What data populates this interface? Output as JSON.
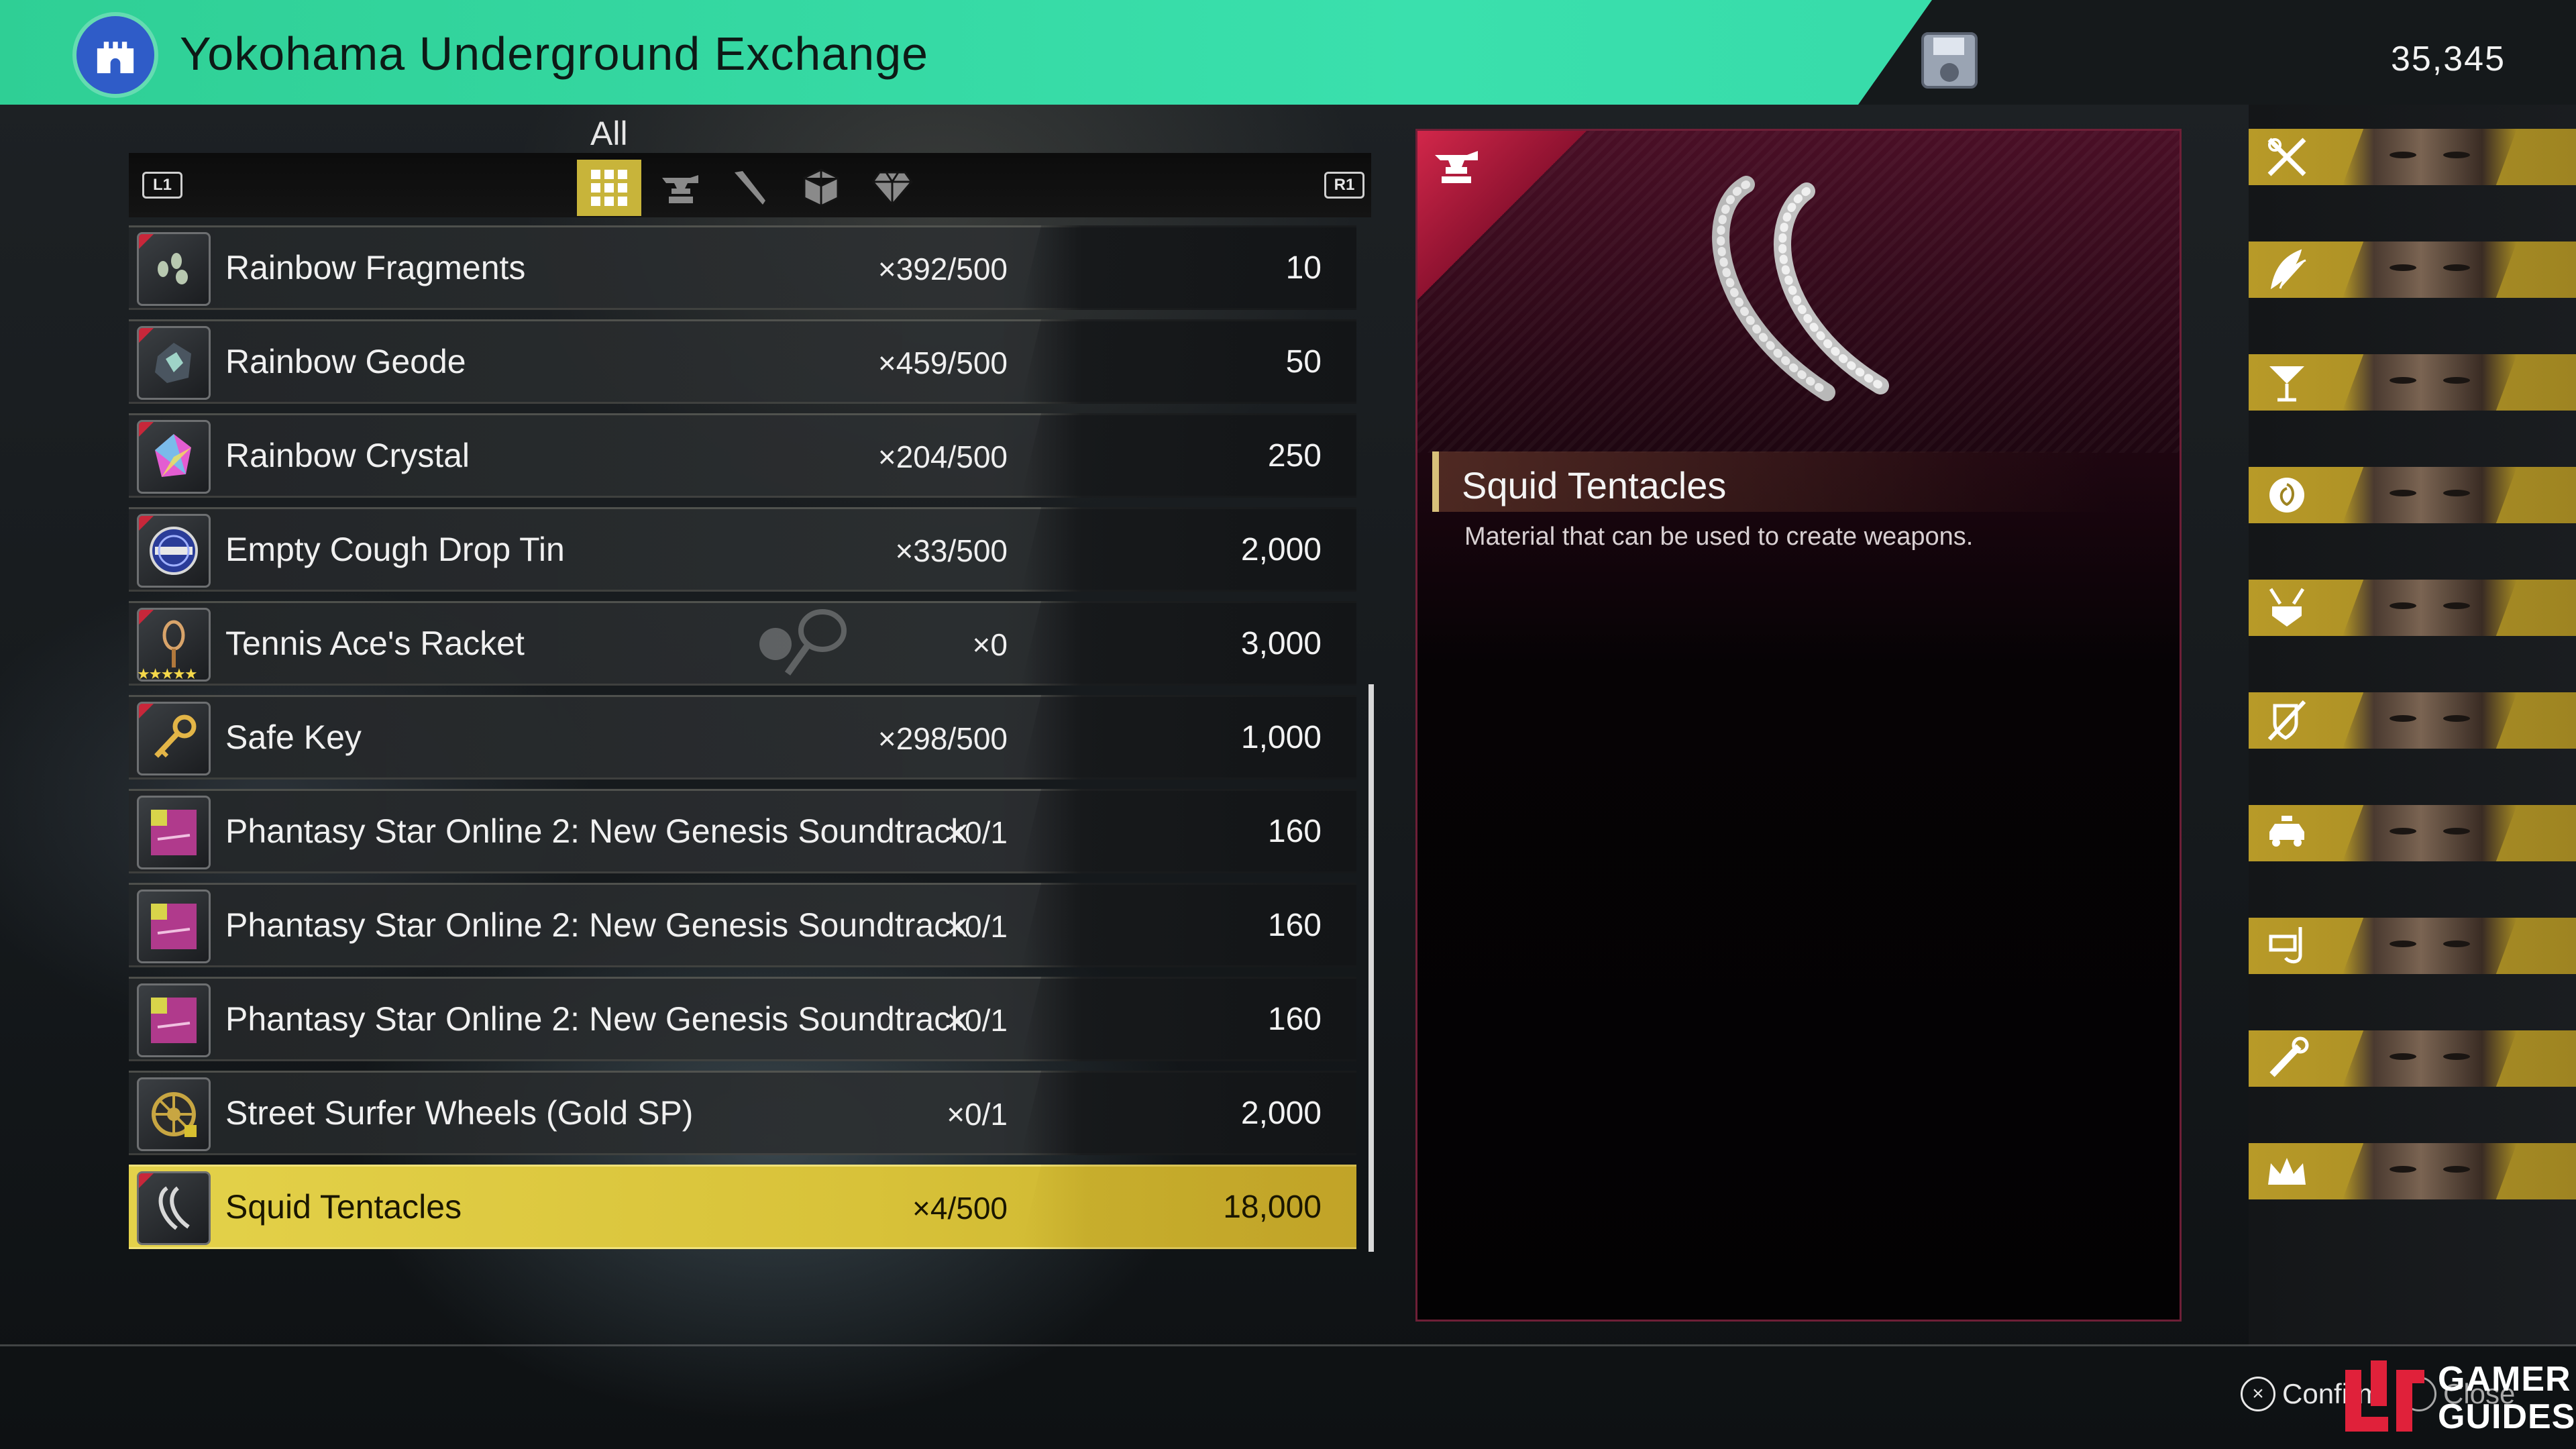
{
  "header": {
    "title": "Yokohama Underground Exchange",
    "money": "35,345"
  },
  "categories": {
    "active_label": "All",
    "left_button": "L1",
    "right_button": "R1",
    "tabs": [
      {
        "icon": "grid-icon",
        "active": true
      },
      {
        "icon": "anvil-icon",
        "active": false
      },
      {
        "icon": "needle-icon",
        "active": false
      },
      {
        "icon": "box-icon",
        "active": false
      },
      {
        "icon": "gem-icon",
        "active": false
      }
    ]
  },
  "items": [
    {
      "name": "Rainbow Fragments",
      "qty": "×392/500",
      "price": "10",
      "icon": "fragments-icon"
    },
    {
      "name": "Rainbow Geode",
      "qty": "×459/500",
      "price": "50",
      "icon": "geode-icon"
    },
    {
      "name": "Rainbow Crystal",
      "qty": "×204/500",
      "price": "250",
      "icon": "crystal-icon"
    },
    {
      "name": "Empty Cough Drop Tin",
      "qty": "×33/500",
      "price": "2,000",
      "icon": "tin-icon"
    },
    {
      "name": "Tennis Ace's Racket",
      "qty": "×0",
      "price": "3,000",
      "icon": "racket-icon",
      "stars": "★★★★★"
    },
    {
      "name": "Safe Key",
      "qty": "×298/500",
      "price": "1,000",
      "icon": "key-icon"
    },
    {
      "name": "Phantasy Star Online 2: New Genesis Soundtrack",
      "qty": "×0/1",
      "price": "160",
      "icon": "album-icon"
    },
    {
      "name": "Phantasy Star Online 2: New Genesis Soundtrack",
      "qty": "×0/1",
      "price": "160",
      "icon": "album-icon"
    },
    {
      "name": "Phantasy Star Online 2: New Genesis Soundtrack",
      "qty": "×0/1",
      "price": "160",
      "icon": "album-icon"
    },
    {
      "name": "Street Surfer Wheels (Gold SP)",
      "qty": "×0/1",
      "price": "2,000",
      "icon": "wheel-icon"
    },
    {
      "name": "Squid Tentacles",
      "qty": "×4/500",
      "price": "18,000",
      "icon": "tentacle-icon",
      "selected": true
    }
  ],
  "detail": {
    "name": "Squid Tentacles",
    "description": "Material that can be used to create weapons.",
    "category_icon": "anvil-icon"
  },
  "party": [
    {
      "job": "crossed-swords-icon"
    },
    {
      "job": "feathers-icon"
    },
    {
      "job": "cocktail-icon"
    },
    {
      "job": "rose-icon"
    },
    {
      "job": "samurai-helmet-icon"
    },
    {
      "job": "sword-shield-icon"
    },
    {
      "job": "taxi-icon"
    },
    {
      "job": "snorkel-icon"
    },
    {
      "job": "wrench-icon"
    },
    {
      "job": "crown-icon"
    }
  ],
  "footer": {
    "confirm_symbol": "×",
    "confirm_label": "Confirm",
    "close_label": "Close",
    "watermark_line1": "GAMER",
    "watermark_line2": "GUIDES"
  },
  "colors": {
    "header": "#3ae0ad",
    "selected_row": "#e4d24a",
    "party_band": "#b89a28",
    "detail_accent": "#d2274a"
  }
}
